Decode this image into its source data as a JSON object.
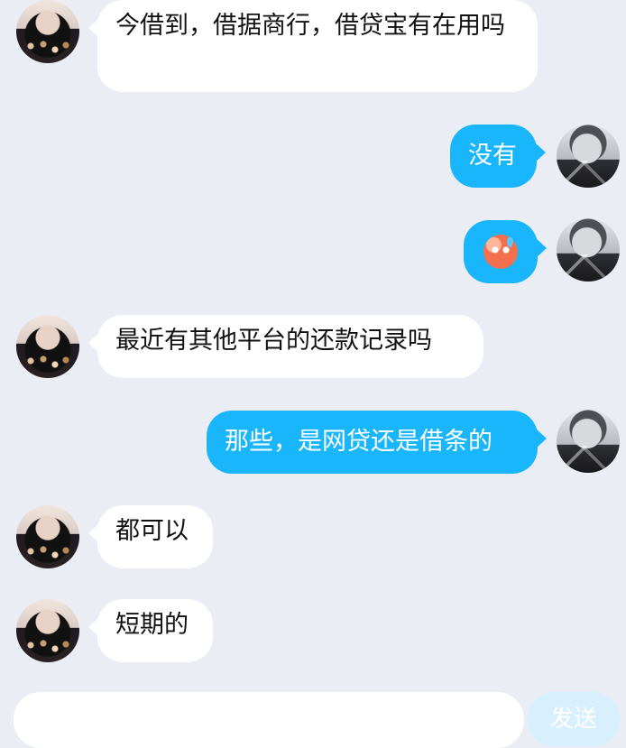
{
  "conversation": {
    "messages": [
      {
        "side": "left",
        "text": "今借到，借据商行，借贷宝有在用吗"
      },
      {
        "side": "right",
        "text": "没有"
      },
      {
        "side": "right",
        "emoji": "sweat-face"
      },
      {
        "side": "left",
        "text": "最近有其他平台的还款记录吗"
      },
      {
        "side": "right",
        "text": "那些，是网贷还是借条的"
      },
      {
        "side": "left",
        "text": "都可以"
      },
      {
        "side": "left",
        "text": "短期的"
      }
    ]
  },
  "composer": {
    "placeholder": "",
    "send_label": "发送"
  },
  "colors": {
    "background": "#ebedf4",
    "incoming_bubble": "#ffffff",
    "outgoing_bubble": "#1ab6fb",
    "send_button": "#d8effd"
  }
}
